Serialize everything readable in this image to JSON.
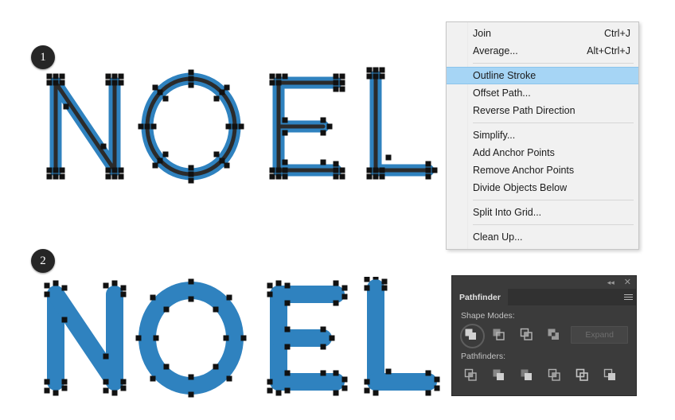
{
  "steps": [
    {
      "number": "1"
    },
    {
      "number": "2"
    }
  ],
  "artwork": {
    "word": "NOEL",
    "stroke_color": "#2b2b2b",
    "fill_color": "#2f82bf",
    "anchor_color": "#111111",
    "top_row_caption": "stroked outlined letters with visible paths and anchor points",
    "bottom_row_caption": "letters after Outline Stroke and Unite, solid filled shapes"
  },
  "menu": {
    "items": [
      {
        "label": "Join",
        "accel": "Ctrl+J",
        "selected": false
      },
      {
        "label": "Average...",
        "accel": "Alt+Ctrl+J",
        "selected": false
      },
      {
        "separator": true
      },
      {
        "label": "Outline Stroke",
        "accel": "",
        "selected": true
      },
      {
        "label": "Offset Path...",
        "accel": "",
        "selected": false
      },
      {
        "label": "Reverse Path Direction",
        "accel": "",
        "selected": false
      },
      {
        "separator": true
      },
      {
        "label": "Simplify...",
        "accel": "",
        "selected": false
      },
      {
        "label": "Add Anchor Points",
        "accel": "",
        "selected": false
      },
      {
        "label": "Remove Anchor Points",
        "accel": "",
        "selected": false
      },
      {
        "label": "Divide Objects Below",
        "accel": "",
        "selected": false
      },
      {
        "separator": true
      },
      {
        "label": "Split Into Grid...",
        "accel": "",
        "selected": false
      },
      {
        "separator": true
      },
      {
        "label": "Clean Up...",
        "accel": "",
        "selected": false
      }
    ],
    "highlight_color": "#a6d5f5",
    "background_color": "#f1f1f1"
  },
  "panel": {
    "titlebar": {
      "collapse_icon": "◂◂",
      "close_icon": "✕"
    },
    "tab_label": "Pathfinder",
    "menu_icon": "panel-menu-icon",
    "shape_modes_label": "Shape Modes:",
    "shape_modes": [
      {
        "name": "unite",
        "selected": true
      },
      {
        "name": "minus-front",
        "selected": false
      },
      {
        "name": "intersect",
        "selected": false
      },
      {
        "name": "exclude",
        "selected": false
      }
    ],
    "expand_label": "Expand",
    "expand_enabled": false,
    "pathfinders_label": "Pathfinders:",
    "pathfinders": [
      {
        "name": "divide"
      },
      {
        "name": "trim"
      },
      {
        "name": "merge"
      },
      {
        "name": "crop"
      },
      {
        "name": "outline"
      },
      {
        "name": "minus-back"
      }
    ],
    "background_color": "#3b3b3b"
  }
}
